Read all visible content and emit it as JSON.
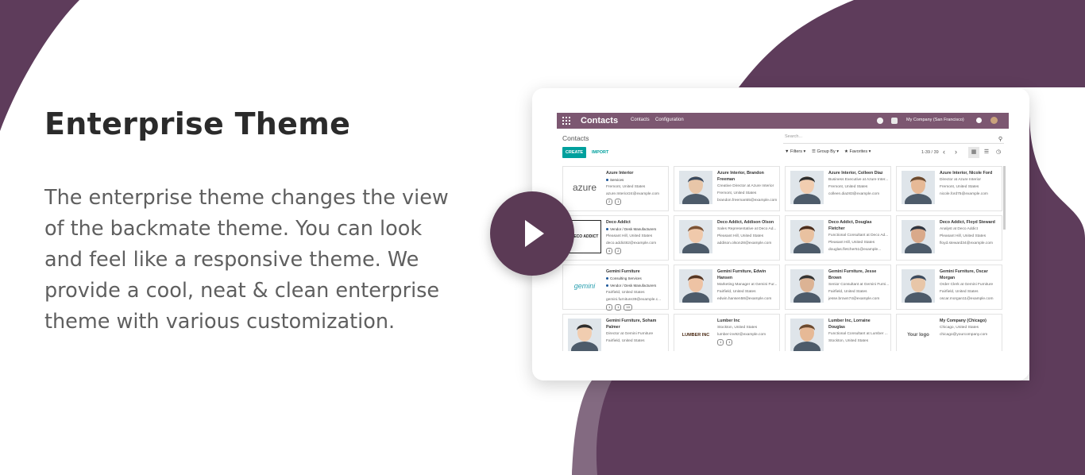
{
  "hero": {
    "title": "Enterprise Theme",
    "description": "The enterprise theme changes the view of the backmate theme. You can look and feel like a responsive theme. We provide a cool, neat & clean enterprise theme with various customization."
  },
  "colors": {
    "brand_purple": "#5b3a55",
    "bg_purple_dark": "#5e3c5b",
    "bg_purple_light": "#836a81",
    "navbar": "#7c5771",
    "accent_teal": "#00a09d"
  },
  "app": {
    "title": "Contacts",
    "menu": [
      "Contacts",
      "Configuration"
    ],
    "company": "My Company (San Francisco)",
    "breadcrumb": "Contacts",
    "search_placeholder": "Search...",
    "create_label": "CREATE",
    "import_label": "IMPORT",
    "filters_label": "Filters",
    "groupby_label": "Group By",
    "favorites_label": "Favorites",
    "pager": "1-39 / 39"
  },
  "contacts": [
    {
      "name": "Azure Interior",
      "tags": [
        "Services"
      ],
      "lines": [
        "Fremont, United States",
        "azure.Interior24@example.com"
      ],
      "badges": [
        "2",
        "1"
      ],
      "thumb": "logo-azure",
      "logo_text": "azure"
    },
    {
      "name": "Azure Interior, Brandon\nFreeman",
      "tags": [],
      "lines": [
        "Creative Director at Azure Interior",
        "Fremont, United States",
        "brandon.freeman55@example.com"
      ],
      "badges": [],
      "thumb": "person"
    },
    {
      "name": "Azure Interior, Colleen Diaz",
      "tags": [],
      "lines": [
        "Business Executive at Azure Inter...",
        "Fremont, United States",
        "colleen.diaz83@example.com"
      ],
      "badges": [],
      "thumb": "person"
    },
    {
      "name": "Azure Interior, Nicole Ford",
      "tags": [],
      "lines": [
        "Director at Azure Interior",
        "Fremont, United States",
        "nicole.ford75@example.com"
      ],
      "badges": [],
      "thumb": "person"
    },
    {
      "name": "Deco Addict",
      "tags": [
        "Vendor / Desk Manufacturers"
      ],
      "lines": [
        "Pleasant Hill, United States",
        "deco.addict82@example.com"
      ],
      "badges": [
        "4",
        "2"
      ],
      "thumb": "logo-deco",
      "logo_text": "DECO ADDICT"
    },
    {
      "name": "Deco Addict, Addison Olson",
      "tags": [],
      "lines": [
        "Sales Representative at Deco Ad...",
        "Pleasant Hill, United States",
        "addison.olson28@example.com"
      ],
      "badges": [],
      "thumb": "person"
    },
    {
      "name": "Deco Addict, Douglas\nFletcher",
      "tags": [],
      "lines": [
        "Functional Consultant at Deco Ad...",
        "Pleasant Hill, United States",
        "douglas.fletcher51@example..."
      ],
      "badges": [],
      "thumb": "person"
    },
    {
      "name": "Deco Addict, Floyd Steward",
      "tags": [],
      "lines": [
        "Analyst at Deco Addict",
        "Pleasant Hill, United States",
        "floyd.steward34@example.com"
      ],
      "badges": [],
      "thumb": "person"
    },
    {
      "name": "Gemini Furniture",
      "tags": [
        "Consulting Services",
        "Vendor / Desk Manufacturers"
      ],
      "lines": [
        "Fairfield, United States",
        "gemini.furniture39@example.c..."
      ],
      "badges": [
        "1",
        "1",
        "10"
      ],
      "thumb": "logo-gemini",
      "logo_text": "gemini"
    },
    {
      "name": "Gemini Furniture, Edwin\nHansen",
      "tags": [],
      "lines": [
        "Marketing Manager at Gemini Fur...",
        "Fairfield, United States",
        "edwin.hansen58@example.com"
      ],
      "badges": [],
      "thumb": "person"
    },
    {
      "name": "Gemini Furniture, Jesse\nBrown",
      "tags": [],
      "lines": [
        "Senior Consultant at Gemini Furni...",
        "Fairfield, United States",
        "jesse.brown74@example.com"
      ],
      "badges": [],
      "thumb": "person"
    },
    {
      "name": "Gemini Furniture, Oscar\nMorgan",
      "tags": [],
      "lines": [
        "Order Clerk at Gemini Furniture",
        "Fairfield, United States",
        "oscar.morgan11@example.com"
      ],
      "badges": [],
      "thumb": "person"
    },
    {
      "name": "Gemini Furniture, Soham\nPalmer",
      "tags": [],
      "lines": [
        "Director at Gemini Furniture",
        "Fairfield, United States"
      ],
      "badges": [],
      "thumb": "person"
    },
    {
      "name": "Lumber Inc",
      "tags": [],
      "lines": [
        "Stockton, United States",
        "lumber-inv92@example.com"
      ],
      "badges": [
        "1",
        "1"
      ],
      "thumb": "logo-lumber",
      "logo_text": "LUMBER INC"
    },
    {
      "name": "Lumber Inc, Lorraine\nDouglas",
      "tags": [],
      "lines": [
        "Functional Consultant at Lumber ...",
        "Stockton, United States"
      ],
      "badges": [],
      "thumb": "person"
    },
    {
      "name": "My Company (Chicago)",
      "tags": [],
      "lines": [
        "Chicago, United States",
        "chicago@yourcompany.com"
      ],
      "badges": [],
      "thumb": "logo-yourlogo",
      "logo_text": "Your logo"
    }
  ]
}
